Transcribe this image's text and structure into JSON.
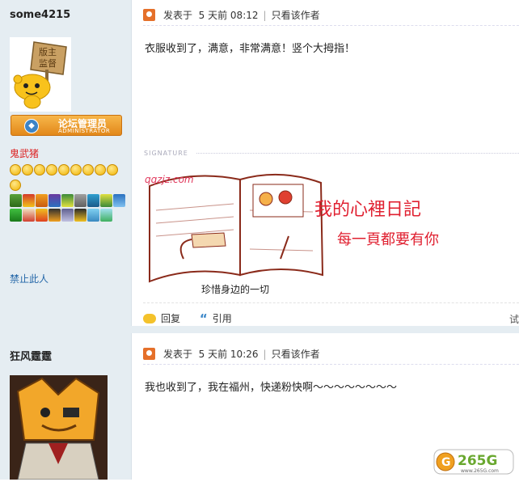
{
  "posts": [
    {
      "author": {
        "username": "some4215",
        "avatar_sign": "版主\n监督",
        "rank_title": "论坛管理员",
        "rank_subtitle": "ADMINISTRATOR",
        "group_name": "鬼武猪",
        "ban_link": "禁止此人"
      },
      "header": {
        "posted_label": "发表于",
        "time": "5 天前 08:12",
        "only_author": "只看该作者"
      },
      "message": "衣服收到了，满意，非常满意！竖个大拇指！",
      "signature": {
        "label": "SIGNATURE",
        "site_text": "qqzjz.com",
        "title_text": "我的心裡日記",
        "subtitle_text": "每一頁都要有你",
        "caption": "珍惜身边的一切"
      },
      "actions": {
        "reply": "回复",
        "quote": "引用",
        "edge": "试"
      }
    },
    {
      "author": {
        "username": "狂风霆霆"
      },
      "header": {
        "posted_label": "发表于",
        "time": "5 天前 10:26",
        "only_author": "只看该作者"
      },
      "message": "我也收到了，我在福州，快递粉快啊～～～～～～～～"
    }
  ],
  "watermark": {
    "text": "265G",
    "sub": "www.265G.com"
  },
  "colors": {
    "sidebar_bg": "#e5edf2",
    "link": "#2366a8",
    "group": "#d22222",
    "header_icon": "#e5702a"
  }
}
